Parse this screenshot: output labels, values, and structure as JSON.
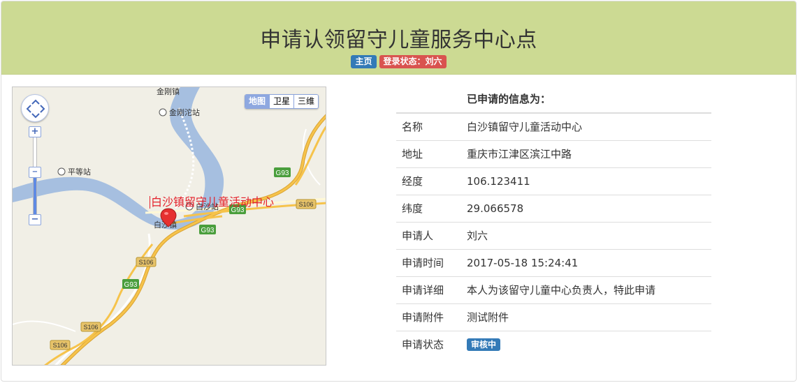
{
  "header": {
    "title": "申请认领留守儿童服务中心点",
    "home_label": "主页",
    "login_status": "登录状态：刘六"
  },
  "map": {
    "maptypes": [
      "地图",
      "卫星",
      "三维"
    ],
    "marker_label": "白沙镇留守儿童活动中心",
    "place_labels": {
      "jingang_town": "金刚镇",
      "jingangtuo_station": "金刚沱站",
      "pingdeng_station": "平等站",
      "baisha_station": "白沙站",
      "baisha_town": "白沙镇"
    },
    "road_labels": [
      "G93",
      "G93",
      "G93",
      "G93",
      "S106",
      "S106",
      "S106",
      "S106"
    ]
  },
  "info": {
    "heading": "已申请的信息为：",
    "rows": [
      {
        "key": "名称",
        "value": "白沙镇留守儿童活动中心"
      },
      {
        "key": "地址",
        "value": "重庆市江津区滨江中路"
      },
      {
        "key": "经度",
        "value": "106.123411"
      },
      {
        "key": "纬度",
        "value": "29.066578"
      },
      {
        "key": "申请人",
        "value": "刘六"
      },
      {
        "key": "申请时间",
        "value": "2017-05-18 15:24:41"
      },
      {
        "key": "申请详细",
        "value": "本人为该留守儿童中心负责人，特此申请"
      },
      {
        "key": "申请附件",
        "value": "测试附件"
      }
    ],
    "status_key": "申请状态",
    "status_value": "审核中"
  }
}
